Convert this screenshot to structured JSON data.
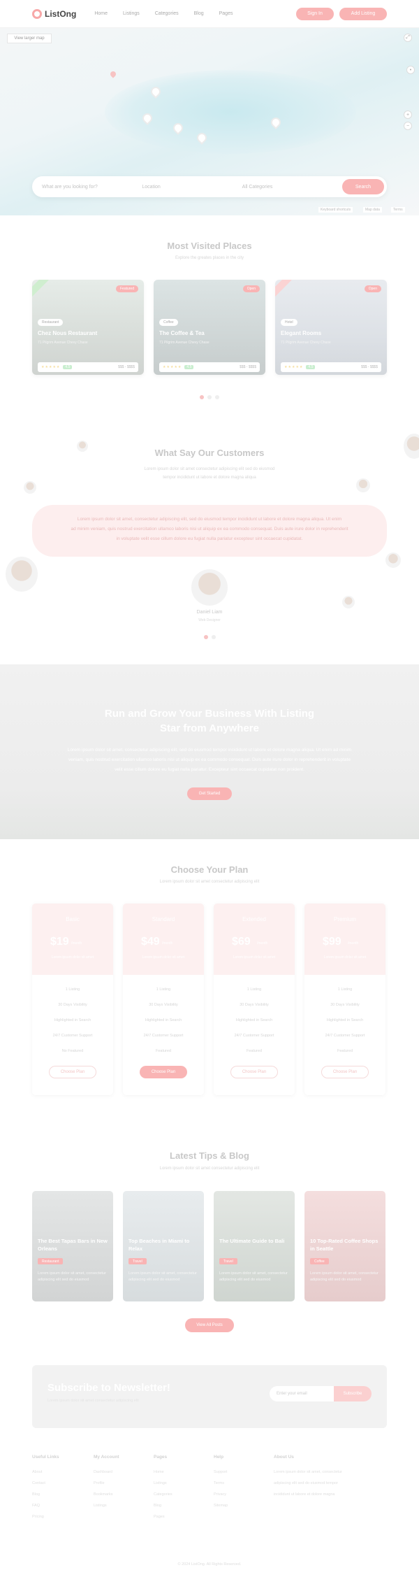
{
  "header": {
    "logo": "ListOng",
    "nav": [
      "Home",
      "Listings",
      "Categories",
      "Blog",
      "Pages"
    ],
    "signin_label": "Sign In",
    "add_listing_label": "Add Listing"
  },
  "map": {
    "button_label": "View larger map",
    "search": {
      "what_placeholder": "What are you looking for?",
      "where_placeholder": "Location",
      "category_placeholder": "All Categories",
      "button_label": "Search"
    },
    "attribution": [
      "Keyboard shortcuts",
      "Map data",
      "Terms"
    ]
  },
  "places": {
    "title": "Most Visited Places",
    "subtitle": "Explore the greates places in the city",
    "cards": [
      {
        "tag": "Featured",
        "category": "Restaurant",
        "name": "Chez Nous Restaurant",
        "address": "71 Pilgrim Avenue Chevy Chase",
        "rating": "4.5",
        "price": "$$$ - $$$$"
      },
      {
        "tag": "Open",
        "category": "Coffee",
        "name": "The Coffee & Tea",
        "address": "71 Pilgrim Avenue Chevy Chase",
        "rating": "4.5",
        "price": "$$$ - $$$$"
      },
      {
        "tag": "Open",
        "category": "Hotel",
        "name": "Elegant Rooms",
        "address": "71 Pilgrim Avenue Chevy Chase",
        "rating": "4.5",
        "price": "$$$ - $$$$"
      }
    ]
  },
  "testimonials": {
    "title": "What Say Our Customers",
    "subtitle_lines": [
      "Lorem ipsum dolor sit amet consectetur adipiscing elit sed do eiusmod",
      "tempor incididunt ut labore et dolore magna aliqua"
    ],
    "quote_lines": [
      "Lorem ipsum dolor sit amet, consectetur adipiscing elit, sed do eiusmod tempor incididunt ut labore et dolore magna aliqua. Ut enim",
      "ad minim veniam, quis nostrud exercitation ullamco laboris nisi ut aliquip ex ea commodo consequat. Duis aute irure dolor in reprehenderit",
      "in voluptate velit esse cillum dolore eu fugiat nulla pariatur excepteur sint occaecat cupidatat."
    ],
    "name": "Daniel Liam",
    "role": "Web Designer"
  },
  "business": {
    "title_lines": [
      "Run and Grow Your Business With Listing",
      "Star from Anywhere"
    ],
    "text_lines": [
      "Lorem ipsum dolor sit amet, consectetur adipiscing elit, sed do eiusmod tempor incididunt ut labore et dolore magna aliqua. Ut enim ad minim",
      "veniam, quis nostrud exercitation ullamco laboris nisi ut aliquip ex ea commodo consequat. Duis aute irure dolor in reprehenderit in voluptate",
      "velit esse cillum dolore eu fugiat nulla pariatur. Excepteur sint occaecat cupidatat non proident."
    ],
    "button_label": "Get Started"
  },
  "plans": {
    "title": "Choose Your Plan",
    "subtitle": "Lorem ipsum dolor sit amet consectetur adipiscing elit",
    "items": [
      {
        "name": "Basic",
        "price": "$19",
        "period": "/month",
        "desc": "Lorem ipsum dolor sit amet",
        "features": [
          "1 Listing",
          "30 Days Visibility",
          "Highlighted in Search",
          "24/7 Customer Support",
          "No Featured"
        ],
        "button": "Choose Plan",
        "highlight": false
      },
      {
        "name": "Standard",
        "price": "$49",
        "period": "/month",
        "desc": "Lorem ipsum dolor sit amet",
        "features": [
          "1 Listing",
          "30 Days Visibility",
          "Highlighted in Search",
          "24/7 Customer Support",
          "Featured"
        ],
        "button": "Choose Plan",
        "highlight": true
      },
      {
        "name": "Extended",
        "price": "$69",
        "period": "/month",
        "desc": "Lorem ipsum dolor sit amet",
        "features": [
          "1 Listing",
          "30 Days Visibility",
          "Highlighted in Search",
          "24/7 Customer Support",
          "Featured"
        ],
        "button": "Choose Plan",
        "highlight": false
      },
      {
        "name": "Premium",
        "price": "$99",
        "period": "/month",
        "desc": "Lorem ipsum dolor sit amet",
        "features": [
          "1 Listing",
          "30 Days Visibility",
          "Highlighted in Search",
          "24/7 Customer Support",
          "Featured"
        ],
        "button": "Choose Plan",
        "highlight": false
      }
    ]
  },
  "blog": {
    "title": "Latest Tips & Blog",
    "subtitle": "Lorem ipsum dolor sit amet consectetur adipiscing elit",
    "posts": [
      {
        "title": "The Best Tapas Bars in New Orleans",
        "tag": "Restaurant",
        "excerpt": "Lorem ipsum dolor sit amet, consectetur adipiscing elit sed do eiusmod"
      },
      {
        "title": "Top Beaches in Miami to Relax",
        "tag": "Travel",
        "excerpt": "Lorem ipsum dolor sit amet, consectetur adipiscing elit sed do eiusmod"
      },
      {
        "title": "The Ultimate Guide to Bali",
        "tag": "Travel",
        "excerpt": "Lorem ipsum dolor sit amet, consectetur adipiscing elit sed do eiusmod"
      },
      {
        "title": "10 Top-Rated Coffee Shops in Seattle",
        "tag": "Coffee",
        "excerpt": "Lorem ipsum dolor sit amet, consectetur adipiscing elit sed do eiusmod"
      }
    ],
    "more_label": "View All Posts"
  },
  "newsletter": {
    "title": "Subscribe to Newsletter!",
    "subtitle": "Lorem ipsum dolor sit amet consectetur adipiscing elit",
    "placeholder": "Enter your email",
    "button_label": "Subscribe"
  },
  "footer": {
    "columns": [
      {
        "head": "Useful Links",
        "links": [
          "About",
          "Contact",
          "Blog",
          "FAQ",
          "Pricing"
        ]
      },
      {
        "head": "My Account",
        "links": [
          "Dashboard",
          "Profile",
          "Bookmarks",
          "Listings"
        ]
      },
      {
        "head": "Pages",
        "links": [
          "Home",
          "Listings",
          "Categories",
          "Blog",
          "Pages"
        ]
      },
      {
        "head": "Help",
        "links": [
          "Support",
          "Terms",
          "Privacy",
          "Sitemap"
        ]
      },
      {
        "head": "About Us",
        "links": [
          "Lorem ipsum dolor sit amet, consectetur",
          "adipiscing elit sed do eiusmod tempor",
          "incididunt ut labore et dolore magna"
        ]
      }
    ],
    "copyright": "© 2024 ListOng. All Rights Reserved."
  },
  "colors": {
    "accent": "#f9b4b4",
    "accent_light": "#fdeeee",
    "rating": "#c9eecf"
  }
}
